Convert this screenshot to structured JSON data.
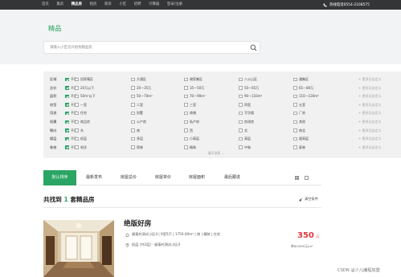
{
  "topnav": {
    "items": [
      "首页",
      "集房",
      "精品房",
      "租房",
      "新房",
      "小区",
      "招聘",
      "计算器",
      "登录/注册"
    ],
    "active_index": 2,
    "hotline": "热线电话0554-2108575"
  },
  "header": {
    "title": "精品",
    "search_placeholder": "请输入小区名开始找精品房"
  },
  "filters": {
    "rows": [
      {
        "label": "区域",
        "all": "不限",
        "options": [
          "田家庵区",
          "大通区",
          "谢家集区",
          "八公山区",
          "潘集区"
        ],
        "more": "+ 更多及自定义"
      },
      {
        "label": "总价",
        "all": "不限",
        "options": [
          "20万以下",
          "20—35万",
          "35—50万",
          "50—65万",
          "65—80万"
        ],
        "more": "+ 更多及自定义"
      },
      {
        "label": "面积",
        "all": "不限",
        "options": [
          "50m²以下",
          "50—70m²",
          "70—90m²",
          "90—110m²",
          "110—130m²"
        ],
        "more": "+ 更多及自定义"
      },
      {
        "label": "房型",
        "all": "不限",
        "options": [
          "一室",
          "二室",
          "三室",
          "四室",
          "五室"
        ],
        "more": "+ 更多及自定义"
      },
      {
        "label": "用途",
        "all": "不限",
        "options": [
          "住宅",
          "别墅",
          "商铺",
          "写字楼",
          "厂房"
        ],
        "more": "+ 更多及自定义"
      },
      {
        "label": "权属",
        "all": "不限",
        "options": [
          "商品房",
          "公产房",
          "私产房",
          "房改房",
          "其他"
        ],
        "more": "+ 更多及自定义"
      },
      {
        "label": "朝向",
        "all": "不限",
        "options": [
          "东",
          "南",
          "西",
          "北",
          "南北"
        ],
        "more": "+ 更多及自定义"
      },
      {
        "label": "楼层",
        "all": "不限",
        "options": [
          "低层",
          "多层",
          "小高层",
          "高层",
          "超高层"
        ],
        "more": "+ 更多及自定义"
      },
      {
        "label": "装修",
        "all": "不限",
        "options": [
          "毛坯",
          "简装",
          "精装",
          "中装",
          "豪装"
        ],
        "more": "+ 更多及自定义"
      }
    ],
    "expand_label": "展开选项"
  },
  "sort": {
    "tabs": [
      "默认排序",
      "最新发布",
      "房屋总价",
      "房屋单价",
      "房屋面积",
      "最后跟进"
    ],
    "active_index": 0
  },
  "results": {
    "prefix": "共找到",
    "count": "1",
    "suffix": "套精品房",
    "clear_label": "清空条件"
  },
  "listing": {
    "title": "绝版好房",
    "details": "顺泰村测试小区4 | 9室5厅 | 1750.00m² | 南 | 精装 | 住宅",
    "address": "低层 (共2层) - 顺泰村测试小区4",
    "price": "350",
    "price_unit": "万",
    "unit_price": "单价2000元/m²"
  },
  "watermark": "CSDN @少儿编程加盟",
  "colors": {
    "accent": "#2aa564",
    "price": "#e0383e",
    "topbar": "#333537"
  }
}
